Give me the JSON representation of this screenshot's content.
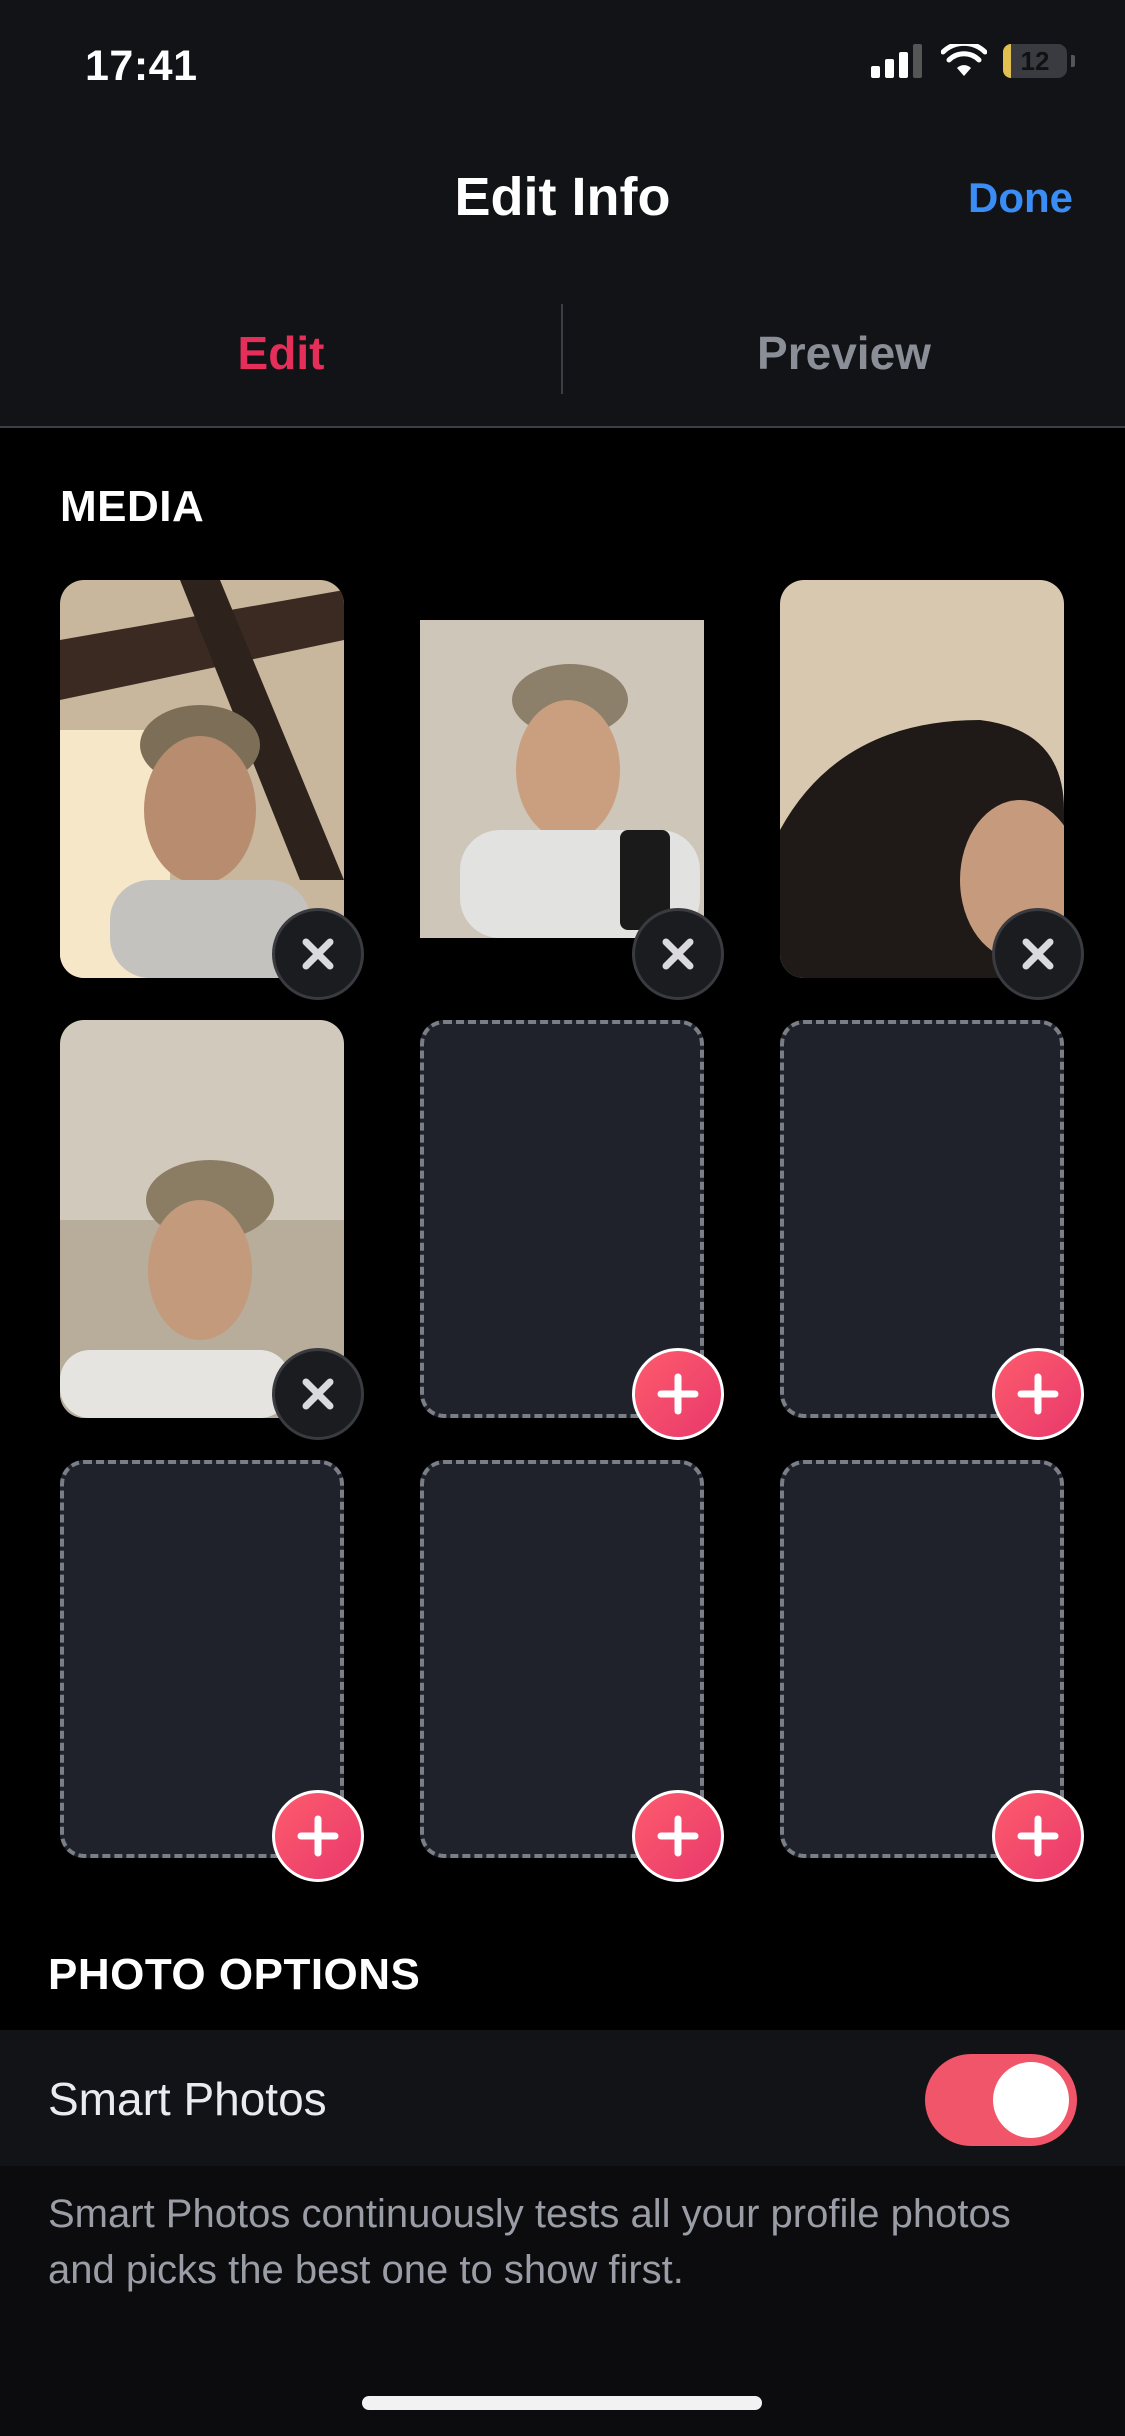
{
  "status_bar": {
    "time": "17:41",
    "battery_level": "12",
    "icons": [
      "signal-icon",
      "wifi-icon",
      "battery-icon"
    ]
  },
  "header": {
    "title": "Edit Info",
    "done_label": "Done"
  },
  "tabs": [
    {
      "label": "Edit",
      "active": true
    },
    {
      "label": "Preview",
      "active": false
    }
  ],
  "media": {
    "title": "MEDIA",
    "tiles": [
      {
        "state": "filled",
        "action": "remove"
      },
      {
        "state": "filled",
        "action": "remove"
      },
      {
        "state": "filled",
        "action": "remove"
      },
      {
        "state": "filled",
        "action": "remove"
      },
      {
        "state": "empty",
        "action": "add"
      },
      {
        "state": "empty",
        "action": "add"
      },
      {
        "state": "empty",
        "action": "add"
      },
      {
        "state": "empty",
        "action": "add"
      },
      {
        "state": "empty",
        "action": "add"
      }
    ]
  },
  "photo_options": {
    "title": "PHOTO OPTIONS",
    "smart_photos_label": "Smart Photos",
    "smart_photos_enabled": true,
    "description": "Smart Photos continuously tests all your profile photos and picks the best one to show first."
  },
  "colors": {
    "accent": "#e52e5a",
    "link": "#3a8df5",
    "toggle_on": "#f0556a",
    "background": "#000000",
    "panel": "#121317"
  }
}
